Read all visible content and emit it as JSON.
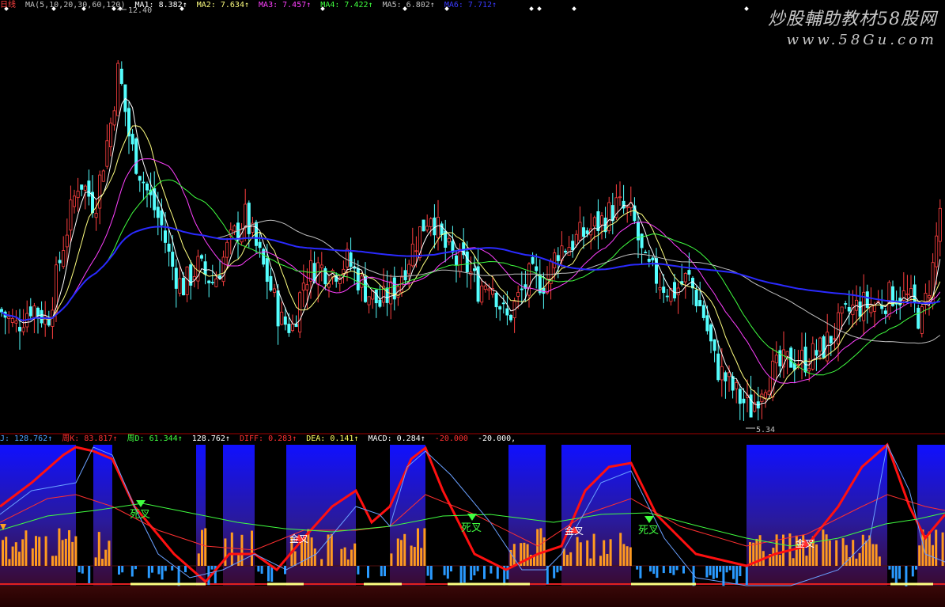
{
  "header": {
    "period": "日线",
    "ma_params": "MA(5,10,20,30,60,120)",
    "ma1": "MA1: 8.382↑",
    "ma2": "MA2: 7.634↑",
    "ma3": "MA3: 7.457↑",
    "ma4": "MA4: 7.422↑",
    "ma5": "MA5: 6.802↑",
    "ma6": "MA6: 7.712↑"
  },
  "sub_header": {
    "j": "J: 128.762↑",
    "k": "周K: 83.817↑",
    "d": "周D: 61.344↑",
    "j2": "128.762↑",
    "diff": "DIFF: 0.283↑",
    "dea": "DEA: 0.141↑",
    "macd": "MACD: 0.284↑",
    "neg20a": "-20.000",
    "neg20b": "-20.000,"
  },
  "watermark": {
    "title": "炒股輔助教材58股网",
    "url": "www.58Gu.com"
  },
  "annotations": {
    "high_label": "12.40",
    "low_label": "5.34",
    "dead_cross": "死叉",
    "golden_cross": "金叉"
  },
  "colors": {
    "bull": "#ff4040",
    "bear": "#54ffff",
    "ma1": "#ffffff",
    "ma2": "#ffff80",
    "ma3": "#ff40ff",
    "ma4": "#40ff40",
    "ma5": "#c0c0c0",
    "ma6": "#2a2aff",
    "dead_cross": "#40ff40",
    "golden_cross": "#ff3030"
  },
  "chart_data": [
    {
      "type": "candlestick",
      "ylim": [
        5.0,
        12.6
      ],
      "price_range": {
        "high": 12.4,
        "low": 5.34,
        "last": 9.2
      },
      "moving_averages": [
        "MA1",
        "MA2",
        "MA3",
        "MA4",
        "MA5",
        "MA6"
      ],
      "close_path": [
        [
          0,
          7.2
        ],
        [
          20,
          6.9
        ],
        [
          40,
          7.3
        ],
        [
          60,
          7.0
        ],
        [
          80,
          8.4
        ],
        [
          100,
          9.6
        ],
        [
          120,
          9.1
        ],
        [
          140,
          10.6
        ],
        [
          150,
          11.6
        ],
        [
          165,
          10.2
        ],
        [
          185,
          9.4
        ],
        [
          205,
          8.7
        ],
        [
          215,
          8.1
        ],
        [
          230,
          7.6
        ],
        [
          250,
          8.0
        ],
        [
          270,
          7.7
        ],
        [
          290,
          8.4
        ],
        [
          310,
          8.9
        ],
        [
          325,
          8.3
        ],
        [
          340,
          7.7
        ],
        [
          355,
          7.0
        ],
        [
          370,
          6.9
        ],
        [
          385,
          7.8
        ],
        [
          400,
          8.0
        ],
        [
          420,
          7.9
        ],
        [
          440,
          8.1
        ],
        [
          460,
          7.6
        ],
        [
          480,
          7.3
        ],
        [
          500,
          7.6
        ],
        [
          515,
          8.1
        ],
        [
          530,
          8.6
        ],
        [
          545,
          9.0
        ],
        [
          560,
          8.4
        ],
        [
          575,
          8.1
        ],
        [
          590,
          8.0
        ],
        [
          605,
          7.6
        ],
        [
          620,
          7.8
        ],
        [
          640,
          7.0
        ],
        [
          655,
          7.4
        ],
        [
          670,
          7.8
        ],
        [
          690,
          7.7
        ],
        [
          705,
          8.3
        ],
        [
          720,
          8.4
        ],
        [
          740,
          8.6
        ],
        [
          760,
          8.8
        ],
        [
          780,
          9.1
        ],
        [
          800,
          8.9
        ],
        [
          815,
          8.0
        ],
        [
          830,
          7.8
        ],
        [
          850,
          7.5
        ],
        [
          870,
          7.8
        ],
        [
          890,
          7.1
        ],
        [
          905,
          6.2
        ],
        [
          920,
          5.9
        ],
        [
          935,
          5.6
        ],
        [
          950,
          5.4
        ],
        [
          965,
          5.9
        ],
        [
          980,
          6.1
        ],
        [
          1000,
          6.3
        ],
        [
          1020,
          6.3
        ],
        [
          1040,
          6.5
        ],
        [
          1060,
          6.9
        ],
        [
          1075,
          7.2
        ],
        [
          1090,
          7.3
        ],
        [
          1110,
          7.3
        ],
        [
          1130,
          7.5
        ],
        [
          1150,
          7.4
        ],
        [
          1165,
          7.0
        ],
        [
          1180,
          8.0
        ],
        [
          1190,
          9.2
        ]
      ]
    },
    {
      "type": "indicator",
      "series": [
        "J",
        "周K",
        "周D",
        "DIFF",
        "DEA",
        "MACD"
      ],
      "values": {
        "J": 128.762,
        "周K": 83.817,
        "周D": 61.344,
        "DIFF": 0.283,
        "DEA": 0.141,
        "MACD": 0.284
      }
    }
  ]
}
